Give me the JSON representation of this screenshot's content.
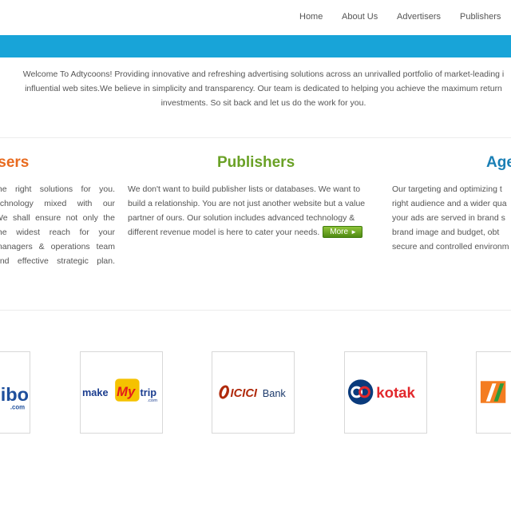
{
  "nav": {
    "items": [
      "Home",
      "About Us",
      "Advertisers",
      "Publishers"
    ]
  },
  "welcome": {
    "lines": [
      "Welcome To Adtycoons! Providing innovative and refreshing advertising solutions across an unrivalled portfolio of market-leading i",
      "influential web sites.We believe in simplicity and transparency. Our team is dedicated to helping you achieve the maximum return",
      "investments. So sit back and let us do the work for you."
    ]
  },
  "columns": {
    "advertisers": {
      "title": "isers",
      "lines": [
        "the right solutions for you.",
        "echnology mixed with our",
        "We shall ensure not only the",
        "the widest reach for your",
        "managers & operations team",
        "and effective strategic plan."
      ]
    },
    "publishers": {
      "title": "Publishers",
      "lines": [
        "We don't want to build publisher lists or databases. We want to",
        "build a relationship. You are not just another website but a value",
        "partner of ours. Our solution includes advanced technology &",
        "different revenue model is here to cater your needs."
      ],
      "more_label": "More"
    },
    "agencies": {
      "title": "Age",
      "lines": [
        "Our targeting and optimizing t",
        "right audience and a wider qua",
        "your ads are served in brand s",
        "brand image and budget, obt",
        "secure and controlled environm"
      ]
    }
  },
  "logos": {
    "ibibo": {
      "text": "ibo",
      "sub": ".com"
    },
    "makemytrip": {
      "make": "make",
      "my": "My",
      "trip": "trip",
      "sub": ".com"
    },
    "icici": {
      "text": "ICICI",
      "bank": "Bank"
    },
    "kotak": {
      "text": "kotak"
    }
  },
  "colors": {
    "blue_bar": "#18a4d8",
    "advertisers_title": "#e86a1e",
    "publishers_title": "#6aa126",
    "agencies_title": "#1a7fb5",
    "kotak_red": "#e2282c",
    "kotak_blue": "#0a3b7c",
    "icici_orange": "#b02a0c",
    "mmt_blue": "#1b3d8f",
    "mmt_red": "#e3191c"
  }
}
